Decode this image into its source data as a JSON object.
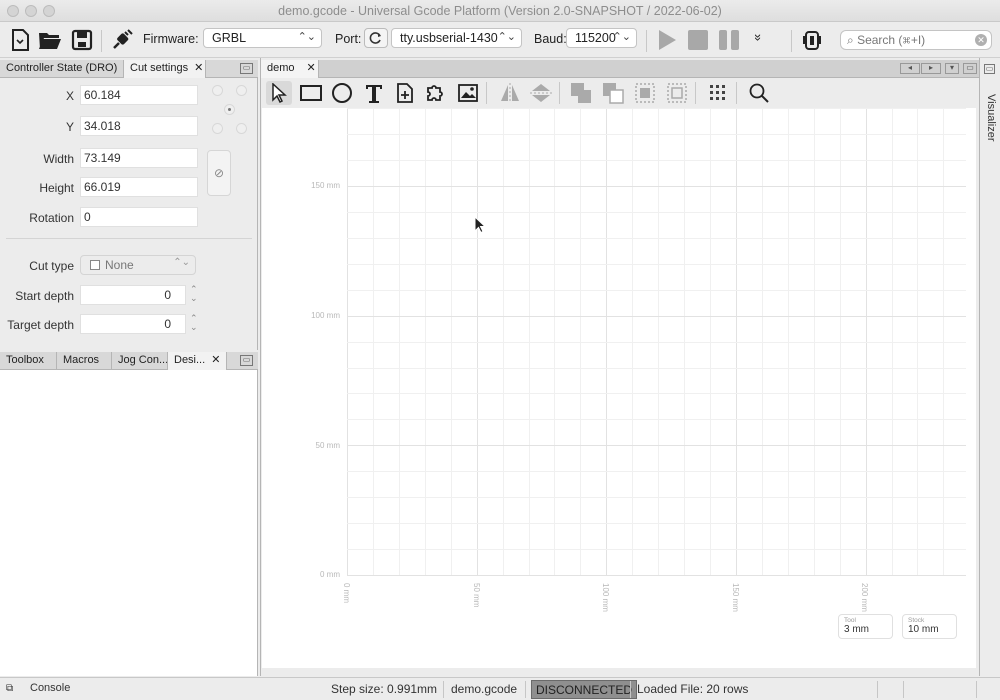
{
  "window": {
    "title": "demo.gcode - Universal Gcode Platform (Version 2.0-SNAPSHOT / 2022-06-02)"
  },
  "toolbar": {
    "firmware_label": "Firmware:",
    "firmware_value": "GRBL",
    "port_label": "Port:",
    "port_value": "tty.usbserial-1430",
    "baud_label": "Baud:",
    "baud_value": "115200",
    "search_placeholder": "Search (⌘+I)",
    "more_glyph": "»"
  },
  "left_top_panel": {
    "tabs": [
      {
        "label": "Controller State (DRO)"
      },
      {
        "label": "Cut settings",
        "active": true
      }
    ],
    "fields": {
      "x": {
        "label": "X",
        "value": "60.184"
      },
      "y": {
        "label": "Y",
        "value": "34.018"
      },
      "width": {
        "label": "Width",
        "value": "73.149"
      },
      "height": {
        "label": "Height",
        "value": "66.019"
      },
      "rotation": {
        "label": "Rotation",
        "value": "0"
      },
      "cut_type": {
        "label": "Cut type",
        "value": "None"
      },
      "start_depth": {
        "label": "Start depth",
        "value": "0"
      },
      "target_depth": {
        "label": "Target depth",
        "value": "0"
      }
    }
  },
  "left_bottom_panel": {
    "tabs": [
      {
        "label": "Toolbox"
      },
      {
        "label": "Macros"
      },
      {
        "label": "Jog Con..."
      },
      {
        "label": "Desi...",
        "active": true
      }
    ]
  },
  "editor": {
    "tab_label": "demo",
    "y_axis_labels": [
      "150 mm",
      "100 mm",
      "50 mm",
      "0 mm"
    ],
    "x_axis_labels": [
      "0 mm",
      "50 mm",
      "100 mm",
      "150 mm",
      "200 mm"
    ],
    "tool": {
      "caption": "Tool",
      "value": "3 mm"
    },
    "stock": {
      "caption": "Stock",
      "value": "10 mm"
    }
  },
  "right_strip": {
    "label": "Visualizer"
  },
  "statusbar": {
    "console": "Console",
    "step_size": "Step size: 0.991mm",
    "file": "demo.gcode",
    "connection": "DISCONNECTED",
    "loaded": "Loaded File: 20 rows"
  },
  "colors": {
    "disconnected_bg": "#8f8f8f",
    "canvas_bg": "#ffffff",
    "grid_major": "#e2e2e2"
  }
}
